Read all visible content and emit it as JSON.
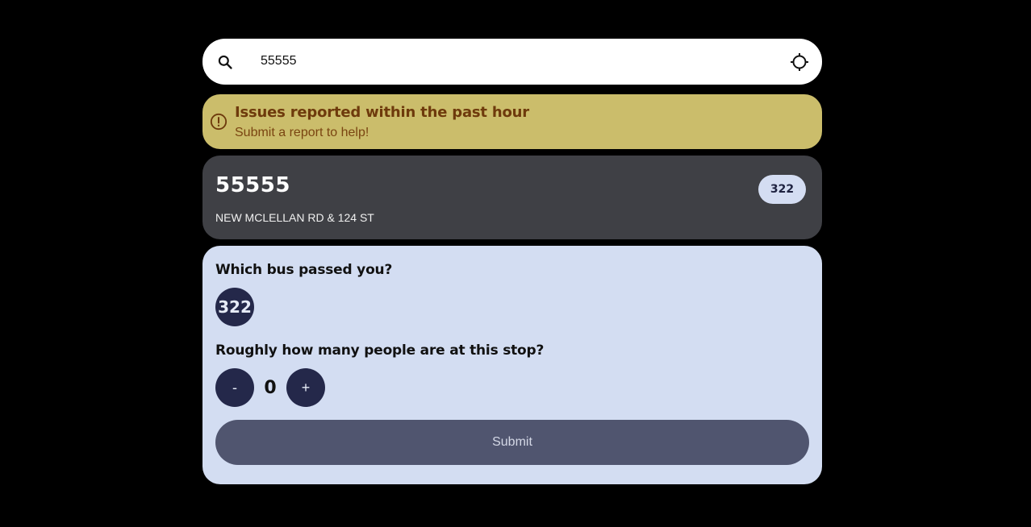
{
  "search": {
    "value": "55555",
    "icon": "search-icon",
    "locate_icon": "crosshair-icon"
  },
  "alert": {
    "icon": "exclamation-circle-icon",
    "title": "Issues reported within the past hour",
    "subtitle": "Submit a report to help!",
    "color": "#cbbd6b"
  },
  "stop": {
    "code": "55555",
    "address": "NEW MCLELLAN RD & 124 ST",
    "routes": [
      "322"
    ]
  },
  "report": {
    "bus_question": "Which bus passed you?",
    "bus_options": [
      "322"
    ],
    "people_question": "Roughly how many people are at this stop?",
    "decrement_label": "-",
    "increment_label": "+",
    "people_count": "0",
    "submit_label": "Submit"
  },
  "colors": {
    "background": "#000000",
    "card_dark": "#3f4045",
    "form_bg": "#d3ddf2",
    "button_dark": "#24284a",
    "submit_bg": "#50556f"
  }
}
